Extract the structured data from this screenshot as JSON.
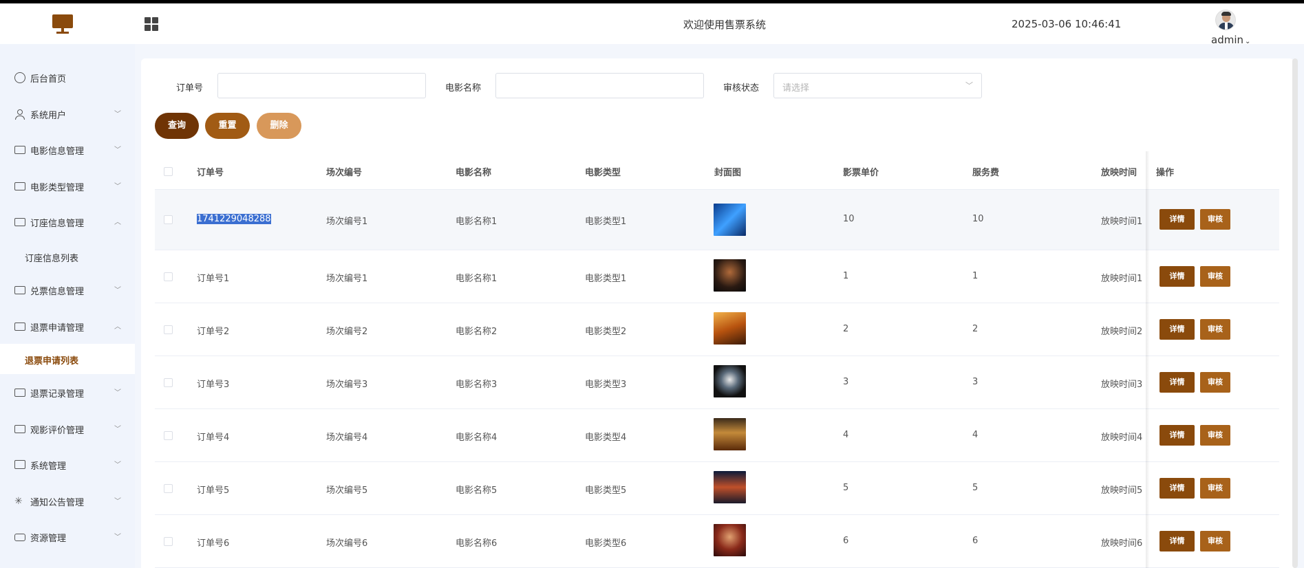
{
  "header": {
    "welcome": "欢迎使用售票系统",
    "datetime": "2025-03-06 10:46:41",
    "username": "admin"
  },
  "sidebar": {
    "items": [
      {
        "label": "后台首页",
        "icon": "clock-icon"
      },
      {
        "label": "系统用户",
        "icon": "user-icon"
      },
      {
        "label": "电影信息管理",
        "icon": "card-icon"
      },
      {
        "label": "电影类型管理",
        "icon": "card-icon"
      },
      {
        "label": "订座信息管理",
        "icon": "card-icon"
      },
      {
        "label": "订座信息列表"
      },
      {
        "label": "兑票信息管理",
        "icon": "card-icon"
      },
      {
        "label": "退票申请管理",
        "icon": "card-icon"
      },
      {
        "label": "退票申请列表"
      },
      {
        "label": "退票记录管理",
        "icon": "card-icon"
      },
      {
        "label": "观影评价管理",
        "icon": "card-icon"
      },
      {
        "label": "系统管理",
        "icon": "check-box-icon"
      },
      {
        "label": "通知公告管理",
        "icon": "loading-icon"
      },
      {
        "label": "资源管理",
        "icon": "cart-icon"
      }
    ]
  },
  "filters": {
    "order_no_label": "订单号",
    "movie_name_label": "电影名称",
    "audit_status_label": "审核状态",
    "audit_status_placeholder": "请选择"
  },
  "buttons": {
    "query": "查询",
    "reset": "重置",
    "delete": "删除"
  },
  "table": {
    "columns": [
      "订单号",
      "场次编号",
      "电影名称",
      "电影类型",
      "封面图",
      "影票单价",
      "服务费",
      "放映时间",
      "操作"
    ],
    "rows": [
      {
        "order_no": "1741229048288",
        "session": "场次编号1",
        "movie": "电影名称1",
        "type": "电影类型1",
        "price": "10",
        "fee": "10",
        "time": "放映时间1"
      },
      {
        "order_no": "订单号1",
        "session": "场次编号1",
        "movie": "电影名称1",
        "type": "电影类型1",
        "price": "1",
        "fee": "1",
        "time": "放映时间1"
      },
      {
        "order_no": "订单号2",
        "session": "场次编号2",
        "movie": "电影名称2",
        "type": "电影类型2",
        "price": "2",
        "fee": "2",
        "time": "放映时间2"
      },
      {
        "order_no": "订单号3",
        "session": "场次编号3",
        "movie": "电影名称3",
        "type": "电影类型3",
        "price": "3",
        "fee": "3",
        "time": "放映时间3"
      },
      {
        "order_no": "订单号4",
        "session": "场次编号4",
        "movie": "电影名称4",
        "type": "电影类型4",
        "price": "4",
        "fee": "4",
        "time": "放映时间4"
      },
      {
        "order_no": "订单号5",
        "session": "场次编号5",
        "movie": "电影名称5",
        "type": "电影类型5",
        "price": "5",
        "fee": "5",
        "time": "放映时间5"
      },
      {
        "order_no": "订单号6",
        "session": "场次编号6",
        "movie": "电影名称6",
        "type": "电影类型6",
        "price": "6",
        "fee": "6",
        "time": "放映时间6"
      }
    ],
    "op_detail": "详情",
    "op_audit": "审核"
  },
  "colors": {
    "brand": "#8a4a0c",
    "query_button": "#6f3405",
    "reset_button": "#a15b14",
    "delete_button": "#d8985a",
    "detail_button": "#8a4a0c",
    "audit_button": "#a8621a"
  }
}
